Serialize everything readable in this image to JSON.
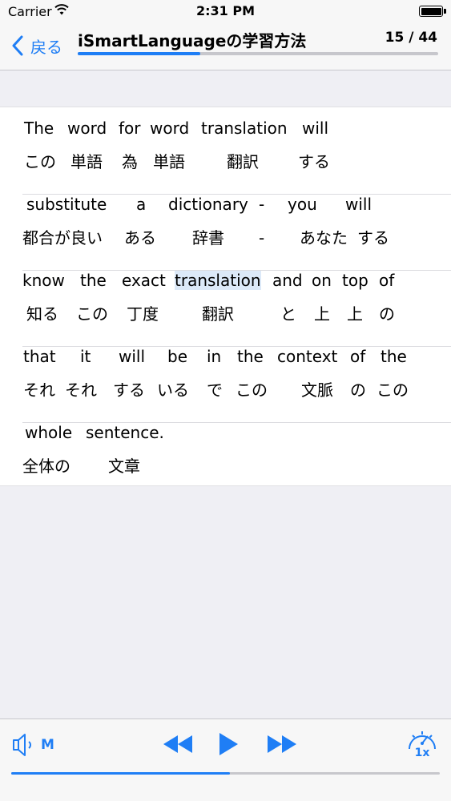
{
  "status": {
    "carrier": "Carrier",
    "time": "2:31 PM"
  },
  "nav": {
    "back_label": "戻る",
    "title": "iSmartLanguageの学習方法",
    "count": "15 / 44",
    "progress_fraction": 0.34
  },
  "lines": [
    [
      {
        "en": "The",
        "ja": "この"
      },
      {
        "en": "word",
        "ja": "単語"
      },
      {
        "en": "for",
        "ja": "為"
      },
      {
        "en": "word",
        "ja": "単語"
      },
      {
        "en": "translation",
        "ja": "翻訳"
      },
      {
        "en": "will",
        "ja": "する"
      }
    ],
    [
      {
        "en": "substitute",
        "ja": "都合が良い"
      },
      {
        "en": "a",
        "ja": "ある"
      },
      {
        "en": "dictionary",
        "ja": "辞書"
      },
      {
        "en": "-",
        "ja": "-"
      },
      {
        "en": "you",
        "ja": "あなた"
      },
      {
        "en": "will",
        "ja": "する"
      }
    ],
    [
      {
        "en": "know",
        "ja": "知る"
      },
      {
        "en": "the",
        "ja": "この"
      },
      {
        "en": "exact",
        "ja": "丁度"
      },
      {
        "en": "translation",
        "ja": "翻訳",
        "highlight": true
      },
      {
        "en": "and",
        "ja": "と"
      },
      {
        "en": "on",
        "ja": "上"
      },
      {
        "en": "top",
        "ja": "上"
      },
      {
        "en": "of",
        "ja": "の"
      }
    ],
    [
      {
        "en": "that",
        "ja": "それ"
      },
      {
        "en": "it",
        "ja": "それ"
      },
      {
        "en": "will",
        "ja": "する"
      },
      {
        "en": "be",
        "ja": "いる"
      },
      {
        "en": "in",
        "ja": "で"
      },
      {
        "en": "the",
        "ja": "この"
      },
      {
        "en": "context",
        "ja": "文脈"
      },
      {
        "en": "of",
        "ja": "の"
      },
      {
        "en": "the",
        "ja": "この"
      }
    ],
    [
      {
        "en": "whole",
        "ja": "全体の"
      },
      {
        "en": "sentence.",
        "ja": "文章"
      }
    ]
  ],
  "player": {
    "volume_mode": "M",
    "speed_label": "1x",
    "progress_fraction": 0.51
  },
  "icons": {
    "back": "chevron-left-icon",
    "speaker": "speaker-icon",
    "rewind": "rewind-icon",
    "play": "play-icon",
    "fast_forward": "fast-forward-icon",
    "speed": "speedometer-icon",
    "wifi": "wifi-icon",
    "battery": "battery-icon"
  },
  "colors": {
    "accent": "#1f7ef5",
    "highlight": "#dce9f8",
    "background": "#efeff4"
  }
}
